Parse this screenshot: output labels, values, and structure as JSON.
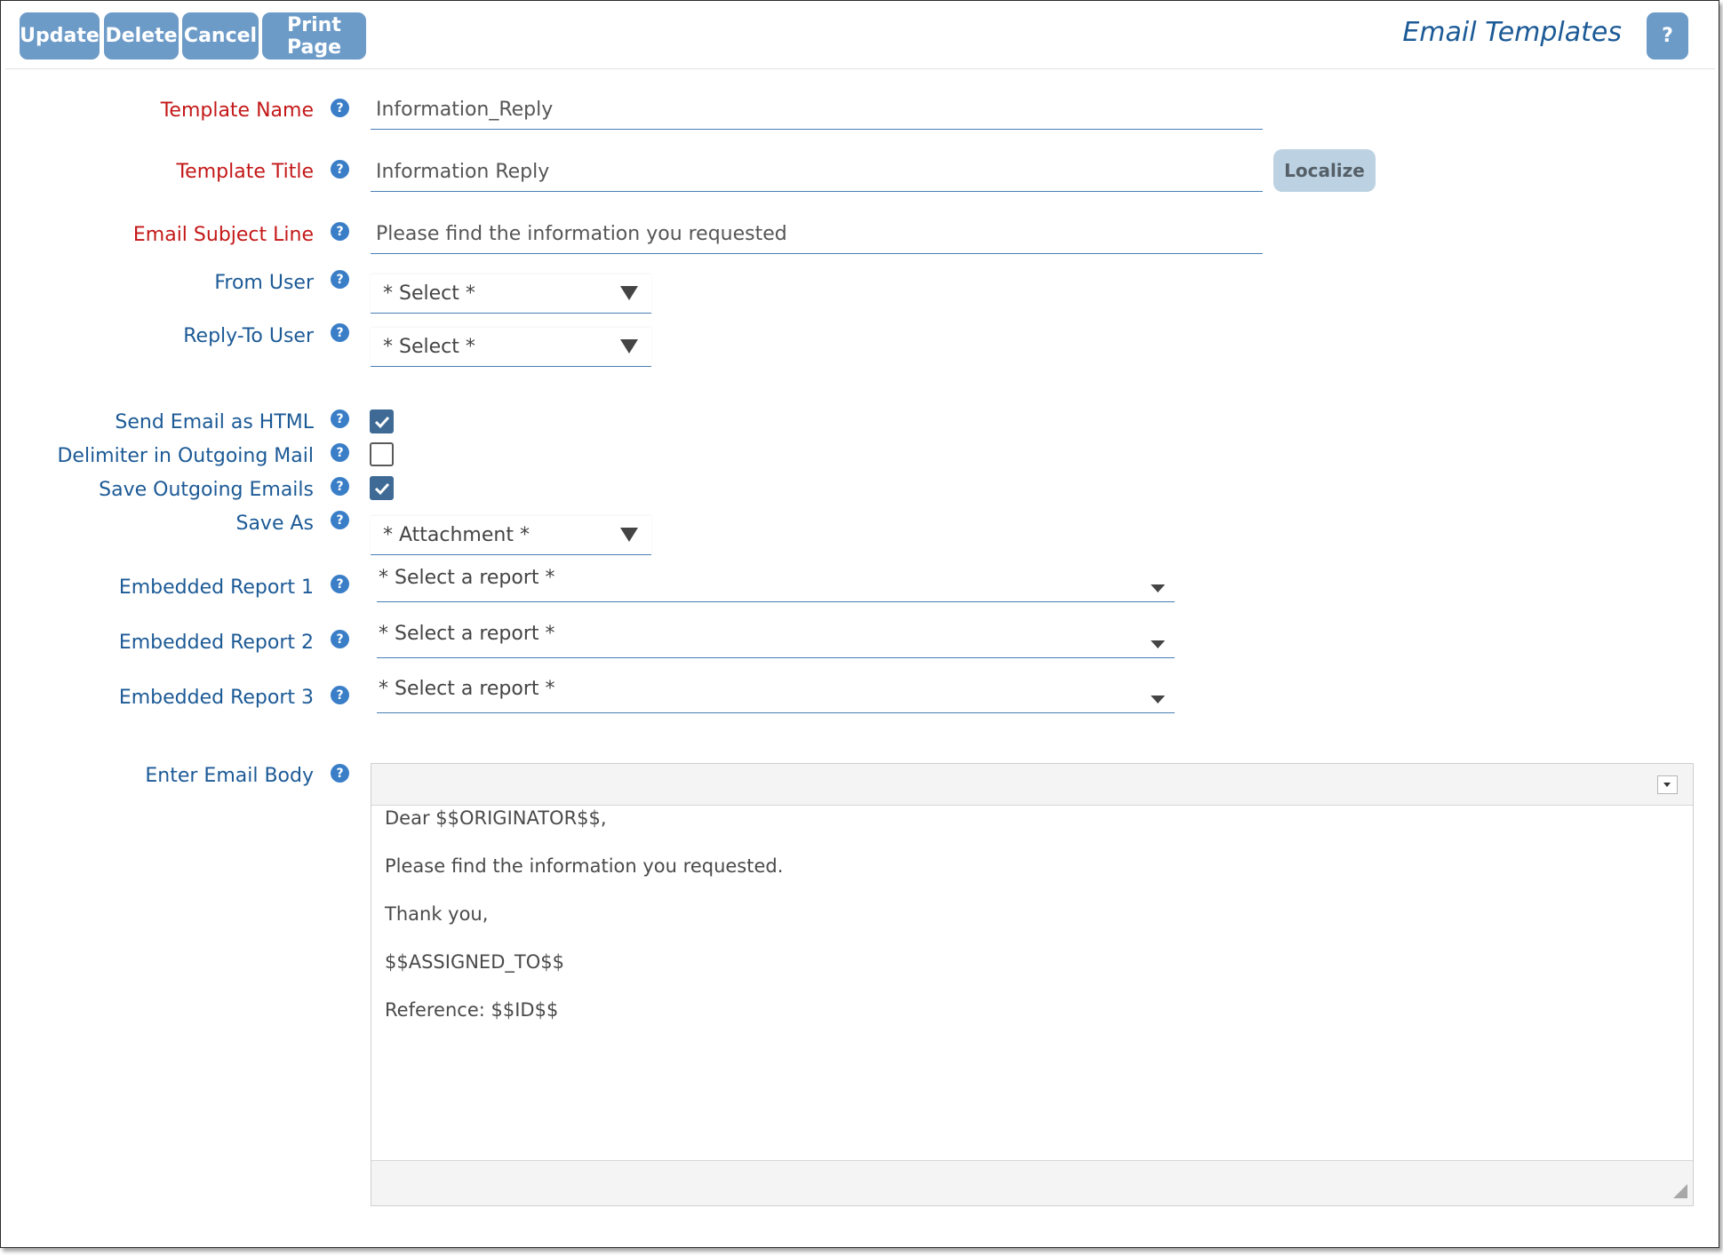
{
  "toolbar": {
    "update": "Update",
    "delete": "Delete",
    "cancel": "Cancel",
    "print_page": "Print Page",
    "title": "Email Templates",
    "help": "?"
  },
  "help_glyph": "?",
  "form": {
    "template_name": {
      "label": "Template Name",
      "value": "Information_Reply"
    },
    "template_title": {
      "label": "Template Title",
      "value": "Information Reply",
      "localize": "Localize"
    },
    "subject": {
      "label": "Email Subject Line",
      "value": "Please find the information you requested"
    },
    "from_user": {
      "label": "From User",
      "value": "* Select *"
    },
    "reply_to": {
      "label": "Reply-To User",
      "value": "* Select *"
    },
    "send_html": {
      "label": "Send Email as HTML",
      "checked": true
    },
    "delimiter": {
      "label": "Delimiter in Outgoing Mail",
      "checked": false
    },
    "save_outgoing": {
      "label": "Save Outgoing Emails",
      "checked": true
    },
    "save_as": {
      "label": "Save As",
      "value": "* Attachment *"
    },
    "report1": {
      "label": "Embedded Report 1",
      "value": "* Select a report *"
    },
    "report2": {
      "label": "Embedded Report 2",
      "value": "* Select a report *"
    },
    "report3": {
      "label": "Embedded Report 3",
      "value": "* Select a report *"
    },
    "body": {
      "label": "Enter Email Body",
      "lines": [
        "Dear $$ORIGINATOR$$,",
        "Please find the information you requested.",
        "Thank you,",
        "$$ASSIGNED_TO$$",
        "Reference: $$ID$$"
      ]
    }
  },
  "colors": {
    "button": "#6d9bc8",
    "required_label": "#c41818",
    "label": "#1c5a96",
    "checkbox_on": "#3e6a95"
  }
}
